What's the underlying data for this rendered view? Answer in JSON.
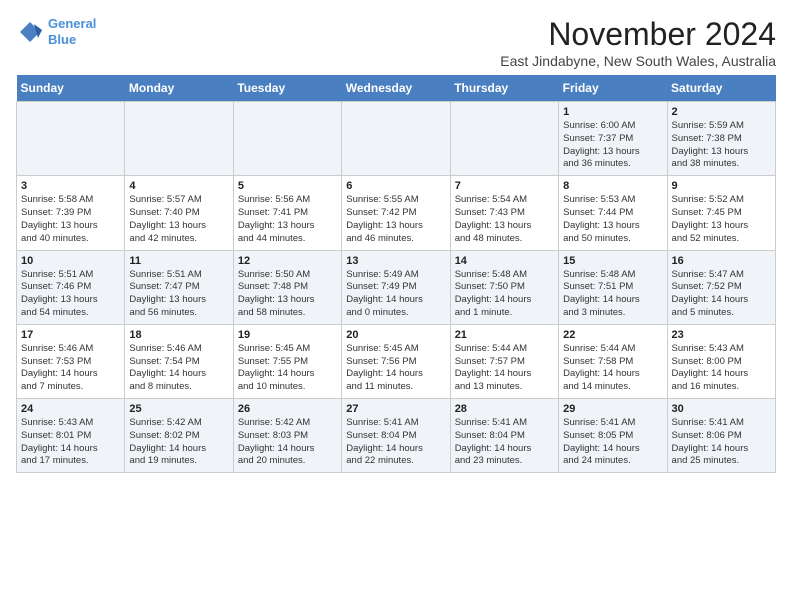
{
  "logo": {
    "line1": "General",
    "line2": "Blue"
  },
  "title": "November 2024",
  "subtitle": "East Jindabyne, New South Wales, Australia",
  "weekdays": [
    "Sunday",
    "Monday",
    "Tuesday",
    "Wednesday",
    "Thursday",
    "Friday",
    "Saturday"
  ],
  "weeks": [
    [
      {
        "day": "",
        "info": ""
      },
      {
        "day": "",
        "info": ""
      },
      {
        "day": "",
        "info": ""
      },
      {
        "day": "",
        "info": ""
      },
      {
        "day": "",
        "info": ""
      },
      {
        "day": "1",
        "info": "Sunrise: 6:00 AM\nSunset: 7:37 PM\nDaylight: 13 hours\nand 36 minutes."
      },
      {
        "day": "2",
        "info": "Sunrise: 5:59 AM\nSunset: 7:38 PM\nDaylight: 13 hours\nand 38 minutes."
      }
    ],
    [
      {
        "day": "3",
        "info": "Sunrise: 5:58 AM\nSunset: 7:39 PM\nDaylight: 13 hours\nand 40 minutes."
      },
      {
        "day": "4",
        "info": "Sunrise: 5:57 AM\nSunset: 7:40 PM\nDaylight: 13 hours\nand 42 minutes."
      },
      {
        "day": "5",
        "info": "Sunrise: 5:56 AM\nSunset: 7:41 PM\nDaylight: 13 hours\nand 44 minutes."
      },
      {
        "day": "6",
        "info": "Sunrise: 5:55 AM\nSunset: 7:42 PM\nDaylight: 13 hours\nand 46 minutes."
      },
      {
        "day": "7",
        "info": "Sunrise: 5:54 AM\nSunset: 7:43 PM\nDaylight: 13 hours\nand 48 minutes."
      },
      {
        "day": "8",
        "info": "Sunrise: 5:53 AM\nSunset: 7:44 PM\nDaylight: 13 hours\nand 50 minutes."
      },
      {
        "day": "9",
        "info": "Sunrise: 5:52 AM\nSunset: 7:45 PM\nDaylight: 13 hours\nand 52 minutes."
      }
    ],
    [
      {
        "day": "10",
        "info": "Sunrise: 5:51 AM\nSunset: 7:46 PM\nDaylight: 13 hours\nand 54 minutes."
      },
      {
        "day": "11",
        "info": "Sunrise: 5:51 AM\nSunset: 7:47 PM\nDaylight: 13 hours\nand 56 minutes."
      },
      {
        "day": "12",
        "info": "Sunrise: 5:50 AM\nSunset: 7:48 PM\nDaylight: 13 hours\nand 58 minutes."
      },
      {
        "day": "13",
        "info": "Sunrise: 5:49 AM\nSunset: 7:49 PM\nDaylight: 14 hours\nand 0 minutes."
      },
      {
        "day": "14",
        "info": "Sunrise: 5:48 AM\nSunset: 7:50 PM\nDaylight: 14 hours\nand 1 minute."
      },
      {
        "day": "15",
        "info": "Sunrise: 5:48 AM\nSunset: 7:51 PM\nDaylight: 14 hours\nand 3 minutes."
      },
      {
        "day": "16",
        "info": "Sunrise: 5:47 AM\nSunset: 7:52 PM\nDaylight: 14 hours\nand 5 minutes."
      }
    ],
    [
      {
        "day": "17",
        "info": "Sunrise: 5:46 AM\nSunset: 7:53 PM\nDaylight: 14 hours\nand 7 minutes."
      },
      {
        "day": "18",
        "info": "Sunrise: 5:46 AM\nSunset: 7:54 PM\nDaylight: 14 hours\nand 8 minutes."
      },
      {
        "day": "19",
        "info": "Sunrise: 5:45 AM\nSunset: 7:55 PM\nDaylight: 14 hours\nand 10 minutes."
      },
      {
        "day": "20",
        "info": "Sunrise: 5:45 AM\nSunset: 7:56 PM\nDaylight: 14 hours\nand 11 minutes."
      },
      {
        "day": "21",
        "info": "Sunrise: 5:44 AM\nSunset: 7:57 PM\nDaylight: 14 hours\nand 13 minutes."
      },
      {
        "day": "22",
        "info": "Sunrise: 5:44 AM\nSunset: 7:58 PM\nDaylight: 14 hours\nand 14 minutes."
      },
      {
        "day": "23",
        "info": "Sunrise: 5:43 AM\nSunset: 8:00 PM\nDaylight: 14 hours\nand 16 minutes."
      }
    ],
    [
      {
        "day": "24",
        "info": "Sunrise: 5:43 AM\nSunset: 8:01 PM\nDaylight: 14 hours\nand 17 minutes."
      },
      {
        "day": "25",
        "info": "Sunrise: 5:42 AM\nSunset: 8:02 PM\nDaylight: 14 hours\nand 19 minutes."
      },
      {
        "day": "26",
        "info": "Sunrise: 5:42 AM\nSunset: 8:03 PM\nDaylight: 14 hours\nand 20 minutes."
      },
      {
        "day": "27",
        "info": "Sunrise: 5:41 AM\nSunset: 8:04 PM\nDaylight: 14 hours\nand 22 minutes."
      },
      {
        "day": "28",
        "info": "Sunrise: 5:41 AM\nSunset: 8:04 PM\nDaylight: 14 hours\nand 23 minutes."
      },
      {
        "day": "29",
        "info": "Sunrise: 5:41 AM\nSunset: 8:05 PM\nDaylight: 14 hours\nand 24 minutes."
      },
      {
        "day": "30",
        "info": "Sunrise: 5:41 AM\nSunset: 8:06 PM\nDaylight: 14 hours\nand 25 minutes."
      }
    ]
  ]
}
